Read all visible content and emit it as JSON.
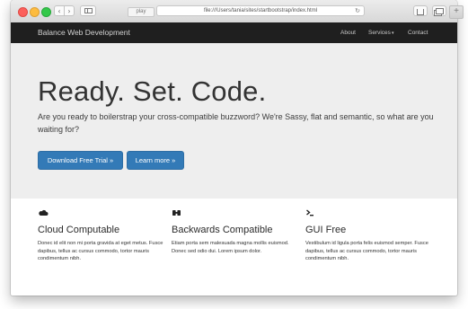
{
  "browser": {
    "tab_label": "play",
    "address": "file:///Users/tania/sites/startbootstrap/index.html",
    "new_tab_label": "+"
  },
  "navbar": {
    "brand": "Balance Web Development",
    "links": {
      "about": "About",
      "services": "Services",
      "contact": "Contact"
    }
  },
  "jumbotron": {
    "title": "Ready. Set. Code.",
    "text": "Are you ready to boilerstrap your cross-compatible buzzword? We're Sassy, flat and semantic, so what are you waiting for?",
    "primary_button": "Download Free Trial »",
    "secondary_button": "Learn more »"
  },
  "features": [
    {
      "icon": "cloud-icon",
      "title": "Cloud Computable",
      "text": "Donec id elit non mi porta gravida at eget metus. Fusce dapibus, tellus ac cursus commodo, tortor mauris condimentum nibh."
    },
    {
      "icon": "binoculars-icon",
      "title": "Backwards Compatible",
      "text": "Etiam porta sem malesuada magna mollis euismod. Donec sed odio dui. Lorem ipsum dolor."
    },
    {
      "icon": "terminal-icon",
      "title": "GUI Free",
      "text": "Vestibulum id ligula porta felis euismod semper. Fusce dapibus, tellus ac cursus commodo, tortor mauris condimentum nibh."
    }
  ],
  "colors": {
    "navbar_bg": "#1f1f1f",
    "jumbotron_bg": "#eeeeee",
    "primary_button": "#337ab7"
  }
}
